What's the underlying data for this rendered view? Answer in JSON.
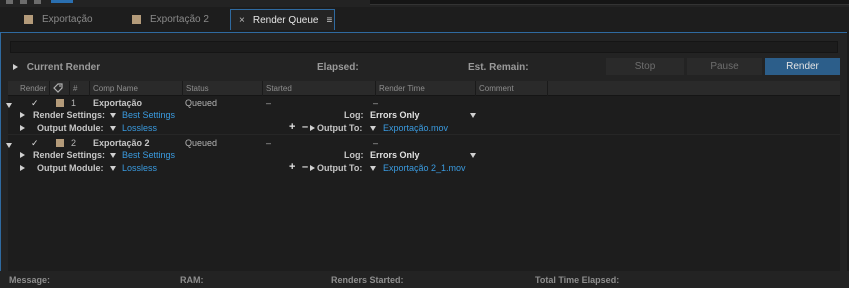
{
  "tabs": [
    {
      "label": "Exportação",
      "active": false
    },
    {
      "label": "Exportação 2",
      "active": false
    },
    {
      "label": "Render Queue",
      "active": true
    }
  ],
  "current_render": {
    "label": "Current Render",
    "elapsed_label": "Elapsed:",
    "est_remain_label": "Est. Remain:"
  },
  "buttons": {
    "stop": "Stop",
    "pause": "Pause",
    "render": "Render"
  },
  "columns": [
    "Render",
    "#",
    "Comp Name",
    "Status",
    "Started",
    "Render Time",
    "Comment"
  ],
  "items": [
    {
      "number": "1",
      "comp_name": "Exportação",
      "status": "Queued",
      "started": "–",
      "render_time": "–",
      "render_settings_label": "Render Settings:",
      "render_settings_value": "Best Settings",
      "log_label": "Log:",
      "log_value": "Errors Only",
      "output_module_label": "Output Module:",
      "output_module_value": "Lossless",
      "output_to_label": "Output To:",
      "output_to_value": "Exportação.mov"
    },
    {
      "number": "2",
      "comp_name": "Exportação 2",
      "status": "Queued",
      "started": "–",
      "render_time": "–",
      "render_settings_label": "Render Settings:",
      "render_settings_value": "Best Settings",
      "log_label": "Log:",
      "log_value": "Errors Only",
      "output_module_label": "Output Module:",
      "output_module_value": "Lossless",
      "output_to_label": "Output To:",
      "output_to_value": "Exportação 2_1.mov"
    }
  ],
  "footer": {
    "message": "Message:",
    "ram": "RAM:",
    "renders_started": "Renders Started:",
    "total_time": "Total Time Elapsed:"
  },
  "colors": {
    "accent": "#2f6aa0",
    "render_button": "#2c5e8a",
    "label_swatch": "#b49b7a",
    "link_blue": "#3a9be0"
  }
}
